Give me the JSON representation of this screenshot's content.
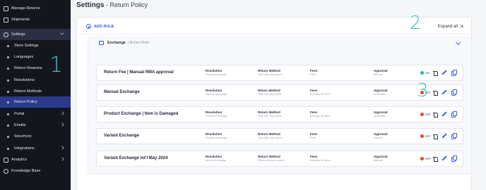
{
  "sidebar": {
    "items": [
      {
        "label": "Manage Returns",
        "type": "top"
      },
      {
        "label": "Shipments",
        "type": "top"
      },
      {
        "label": "Settings",
        "type": "top"
      },
      {
        "label": "Store Settings",
        "type": "sub"
      },
      {
        "label": "Languages",
        "type": "sub"
      },
      {
        "label": "Return Reasons",
        "type": "sub"
      },
      {
        "label": "Resolutions",
        "type": "sub"
      },
      {
        "label": "Return Methods",
        "type": "sub"
      },
      {
        "label": "Return Policy",
        "type": "sub"
      },
      {
        "label": "Portal",
        "type": "sub"
      },
      {
        "label": "Emails",
        "type": "sub"
      },
      {
        "label": "Storefront",
        "type": "sub"
      },
      {
        "label": "Integrations",
        "type": "sub"
      },
      {
        "label": "Analytics",
        "type": "top"
      },
      {
        "label": "Knowledge Base",
        "type": "top"
      }
    ]
  },
  "annotations": {
    "one": "1",
    "two": "2",
    "three": "3"
  },
  "header": {
    "title": "Settings",
    "separator": " - ",
    "subtitle": "Return Policy"
  },
  "toolbar": {
    "add_rule": "ADD RULE",
    "expand_all": "Expand all",
    "expand_icon": "⇲"
  },
  "group": {
    "title": "Exchange",
    "subtitle": "| Active Rule"
  },
  "rules": [
    {
      "name": "Return Fee | Manual RMA approval",
      "res_h": "Resolution",
      "res_v": "Variant exchange",
      "meth_h": "Return Method",
      "meth_v": "Ship with any carrier",
      "fees_h": "Fees",
      "fees_v": "Fees",
      "appr_h": "Approval",
      "appr_v": "Manual",
      "status": "ON",
      "status_color": "#19b8a6"
    },
    {
      "name": "Manual Exchange",
      "res_h": "Resolution",
      "res_v": "Manual exchange",
      "meth_h": "Return Method",
      "meth_v": "Ship with any carrier",
      "fees_h": "Fees",
      "fees_v": "Includes 4H fees",
      "appr_h": "Approval",
      "appr_v": "Automatic",
      "status": "OFF",
      "status_color": "#ec3f2e"
    },
    {
      "name": "Product Exchange | Item is Damaged",
      "res_h": "Resolution",
      "res_v": "Product Exchange",
      "meth_h": "Return Method",
      "meth_v": "Ship with any carrier",
      "fees_h": "Fees",
      "fees_v": "Includes 4H fees",
      "appr_h": "Approval",
      "appr_v": "Automatic",
      "status": "OFF",
      "status_color": "#ec3f2e"
    },
    {
      "name": "Variant Exchange",
      "res_h": "Resolution",
      "res_v": "Product exchange",
      "meth_h": "Return Method",
      "meth_v": "Ship with any carrier",
      "fees_h": "Fees",
      "fees_v": "Free",
      "appr_h": "Approval",
      "appr_v": "Manual",
      "status": "OFF",
      "status_color": "#ec3f2e"
    },
    {
      "name": "Variant Exchange Int'l May 2024",
      "res_h": "Resolution",
      "res_v": "Variant exchange",
      "meth_h": "Return Method",
      "meth_v": "Return Across location",
      "fees_h": "Fees",
      "fees_v": "Includes 4H fees",
      "appr_h": "Approval",
      "appr_v": "Manual",
      "status": "OFF",
      "status_color": "#ec3f2e"
    }
  ]
}
